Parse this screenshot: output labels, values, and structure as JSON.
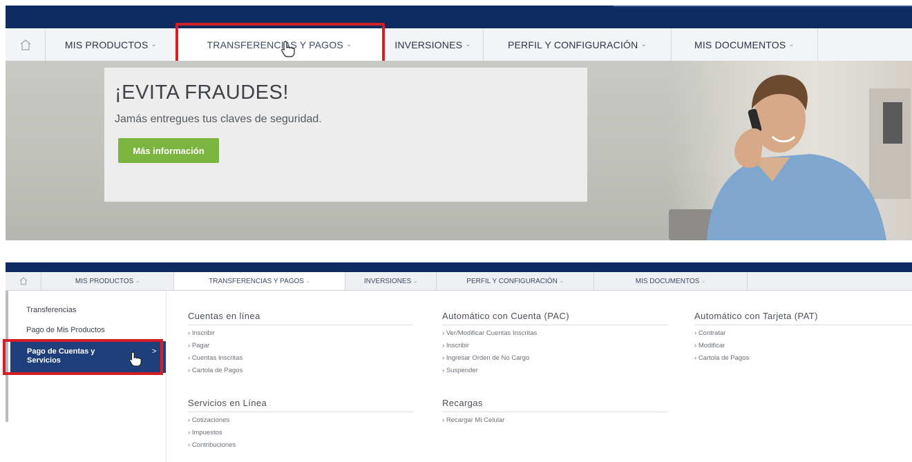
{
  "nav": {
    "items": [
      "MIS PRODUCTOS",
      "TRANSFERENCIAS Y PAGOS",
      "INVERSIONES",
      "PERFIL Y CONFIGURACIÓN",
      "MIS DOCUMENTOS"
    ]
  },
  "banner": {
    "title": "¡EVITA FRAUDES!",
    "subtitle": "Jamás entregues tus claves de seguridad.",
    "button": "Más información"
  },
  "sidebar": {
    "items": [
      "Transferencias",
      "Pago de Mis Productos",
      "Pago de Cuentas y Servicios"
    ]
  },
  "menu": {
    "columns": [
      {
        "title": "Cuentas en línea",
        "links": [
          "Inscribir",
          "Pagar",
          "Cuentas Inscritas",
          "Cartola de Pagos"
        ]
      },
      {
        "title": "Automático con Cuenta (PAC)",
        "links": [
          "Ver/Modificar Cuentas Inscritas",
          "Inscribir",
          "Ingresar Orden de No Cargo",
          "Suspender"
        ]
      },
      {
        "title": "Automático con Tarjeta (PAT)",
        "links": [
          "Contratar",
          "Modificar",
          "Cartola de Pagos"
        ]
      },
      {
        "title": "Servicios en Línea",
        "links": [
          "Cotizaciones",
          "Impuestos",
          "Contribuciones"
        ]
      },
      {
        "title": "Recargas",
        "links": [
          "Recargar Mi Celular"
        ]
      }
    ]
  },
  "colors": {
    "navy": "#0e2a60",
    "highlight": "#d51f26",
    "button": "#7cb440",
    "active": "#1f3f7a"
  }
}
